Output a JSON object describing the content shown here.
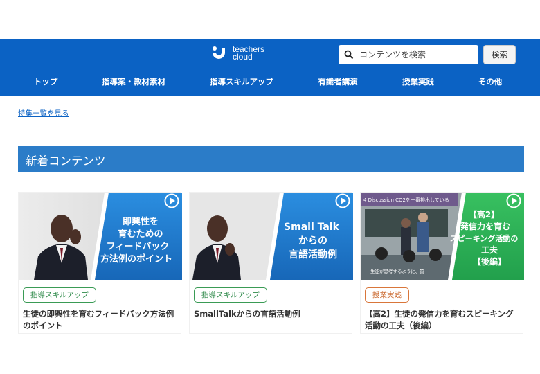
{
  "header": {
    "logo_line1": "teachers",
    "logo_line2": "cloud",
    "search_placeholder": "コンテンツを検索",
    "search_button": "検索"
  },
  "nav": [
    {
      "label": "トップ"
    },
    {
      "label": "指導案・教材素材"
    },
    {
      "label": "指導スキルアップ"
    },
    {
      "label": "有識者講演"
    },
    {
      "label": "授業実践"
    },
    {
      "label": "その他"
    }
  ],
  "feature_link": "特集一覧を見る",
  "section_title": "新着コンテンツ",
  "cards": [
    {
      "thumb_lines": [
        "即興性を",
        "育むための",
        "フィードバック",
        "方法例のポイント"
      ],
      "tag": "指導スキルアップ",
      "title_lines": [
        "生徒の即興性を育むフィードバック方法例",
        "のポイント"
      ]
    },
    {
      "thumb_lines": [
        "Small Talk",
        "からの",
        "言語活動例"
      ],
      "tag": "指導スキルアップ",
      "title_lines": [
        "SmallTalkからの言語活動例"
      ]
    },
    {
      "thumb_lines": [
        "【高2】",
        "発信力を育む",
        "スピーキング活動の",
        "工夫",
        "【後編】"
      ],
      "thumb_caption": "4 Discussion CO2を一番排出している",
      "thumb_subtitle": "生徒が思考するように、質",
      "tag": "授業実践",
      "title_lines": [
        "【高2】生徒の発信力を育むスピーキング",
        "活動の工夫（後編）"
      ]
    }
  ],
  "colors": {
    "header_bg": "#0b62c4",
    "section_bar": "#2b7cc8",
    "thumb_blue": "#1f7fd0",
    "thumb_green": "#2fb45a",
    "tag_green": "#3a9b55",
    "tag_orange": "#d9763a"
  },
  "icons": [
    "logo-icon",
    "search-icon",
    "play-icon"
  ]
}
